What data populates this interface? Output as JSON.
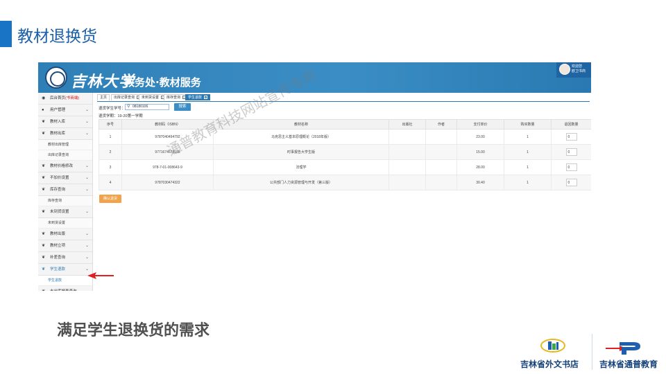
{
  "slide": {
    "title": "教材退换货",
    "caption": "满足学生退换货的需求",
    "watermark": "通普教育科技网站宣传专用",
    "logos": [
      {
        "label": "吉林省外文书店",
        "icon": "bookstore-logo"
      },
      {
        "label": "吉林省通普教育",
        "icon": "tongpu-logo"
      }
    ],
    "colors": {
      "accent": "#1a74c6",
      "header": "#2f7fb7",
      "confirm": "#f2a24a",
      "pointer": "#e02020"
    }
  },
  "app": {
    "brand_calligraphy": "吉林大学",
    "brand_system": "教务处·教材服务",
    "user": {
      "welcome": "欢迎您",
      "name": "欧卫书商"
    }
  },
  "sidebar": {
    "home": {
      "label": "后台首页",
      "hint": "(书商端)"
    },
    "items": [
      {
        "label": "用户管理",
        "icon": "users-icon"
      },
      {
        "label": "教材入库",
        "icon": "leaf-icon"
      },
      {
        "label": "教材出库",
        "icon": "leaf-icon"
      },
      {
        "label": "教材出库管理",
        "sub": true
      },
      {
        "label": "出库记录查询",
        "sub": true
      },
      {
        "label": "教材价格修改",
        "icon": "leaf-icon"
      },
      {
        "label": "不加价设置",
        "icon": "leaf-icon"
      },
      {
        "label": "库存查询",
        "icon": "leaf-icon"
      },
      {
        "label": "库存查询",
        "sub": true
      },
      {
        "label": "未到货设置",
        "icon": "leaf-icon"
      },
      {
        "label": "未到货设置",
        "sub": true
      },
      {
        "label": "教材出版",
        "icon": "leaf-icon"
      },
      {
        "label": "教材立项",
        "icon": "leaf-icon"
      },
      {
        "label": "补差查询",
        "icon": "leaf-icon"
      },
      {
        "label": "学生退款",
        "icon": "leaf-icon",
        "active": true
      },
      {
        "label": "学生退款",
        "sub": true,
        "active": true
      },
      {
        "label": "未出库报表查询",
        "icon": "leaf-icon"
      }
    ]
  },
  "tabs": [
    {
      "label": "主页",
      "closable": false
    },
    {
      "label": "出库记录查询",
      "closable": true
    },
    {
      "label": "未到货设置",
      "closable": true
    },
    {
      "label": "库存查询",
      "closable": true
    },
    {
      "label": "学生退款",
      "closable": true,
      "active": true
    }
  ],
  "search": {
    "label": "退货学生学号：",
    "value": "08180106",
    "button": "搜索",
    "term": "退货学期：19-20第一学期"
  },
  "table": {
    "columns": [
      "序号",
      "教材码（ISBN）",
      "教材名称",
      "出版社",
      "作者",
      "支付单价",
      "购买数量",
      "退回数量"
    ],
    "rows": [
      {
        "no": "1",
        "isbn": "9787040494792",
        "name": "马克思主义基本原理概论（2018年版）",
        "publisher": "",
        "author": "",
        "price": "23.00",
        "qty": "1",
        "return_qty": "0"
      },
      {
        "no": "2",
        "isbn": "9771674678185",
        "name": "时事报告大学生版",
        "publisher": "",
        "author": "",
        "price": "15.00",
        "qty": "1",
        "return_qty": "0"
      },
      {
        "no": "3",
        "isbn": "978-7-01-008643-9",
        "name": "法理学",
        "publisher": "",
        "author": "",
        "price": "28.00",
        "qty": "1",
        "return_qty": "0"
      },
      {
        "no": "4",
        "isbn": "9787030474322",
        "name": "公共部门人力资源管理与开发（第三版）",
        "publisher": "",
        "author": "",
        "price": "30.40",
        "qty": "1",
        "return_qty": "0"
      }
    ]
  },
  "confirm_button": "确认退货"
}
